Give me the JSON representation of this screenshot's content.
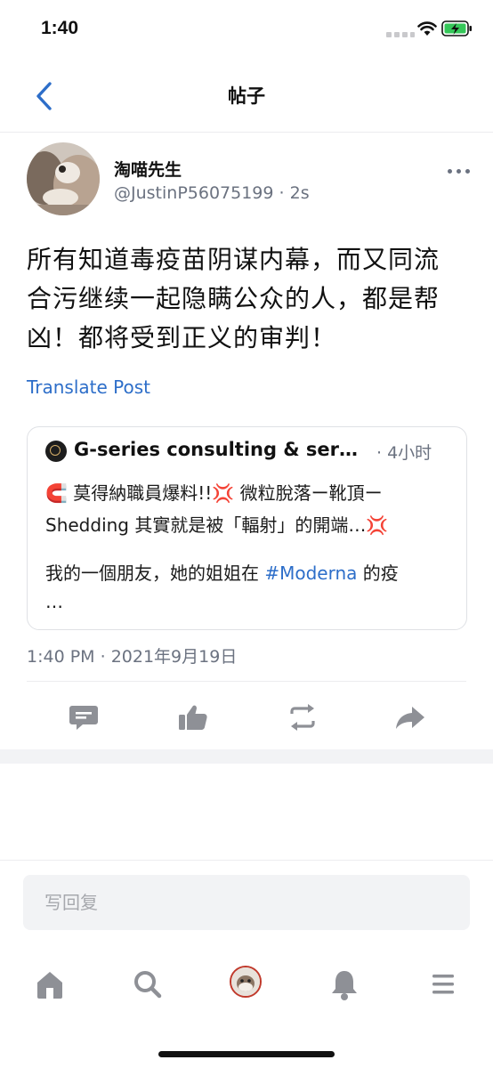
{
  "status_bar": {
    "time": "1:40"
  },
  "nav": {
    "title": "帖子"
  },
  "post": {
    "author_name": "淘喵先生",
    "author_handle": "@JustinP56075199",
    "age": "2s",
    "text": "所有知道毒疫苗阴谋内幕，而又同流合污继续一起隐瞒公众的人，都是帮凶！都将受到正义的审判！",
    "translate_label": "Translate Post",
    "timestamp": "1:40 PM",
    "date": "2021年9月19日"
  },
  "quote": {
    "name": "G-series consulting & services",
    "age": "4小时",
    "line1_emoji": "🧲",
    "line1_text": "莫得納職員爆料!!",
    "line1_emoji2": "💢",
    "line1_text2": "微粒脫落ー靴頂ー",
    "line2_text": "Shedding 其實就是被「輻射」的開端…",
    "line2_emoji": "💢",
    "line3_text": "我的一個朋友，她的姐姐在",
    "line3_tag": "#Moderna",
    "line3_text2": "的疫",
    "line4_text": "…"
  },
  "reply": {
    "placeholder": "写回复"
  },
  "colors": {
    "accent": "#2d6ec9",
    "icon_gray": "#8e9096",
    "alert_red": "#d93025"
  },
  "icons": {
    "actions": [
      "comment-icon",
      "like-icon",
      "repost-icon",
      "share-icon"
    ],
    "tabs": [
      "home-icon",
      "search-icon",
      "profile-avatar",
      "bell-icon",
      "menu-icon"
    ]
  }
}
